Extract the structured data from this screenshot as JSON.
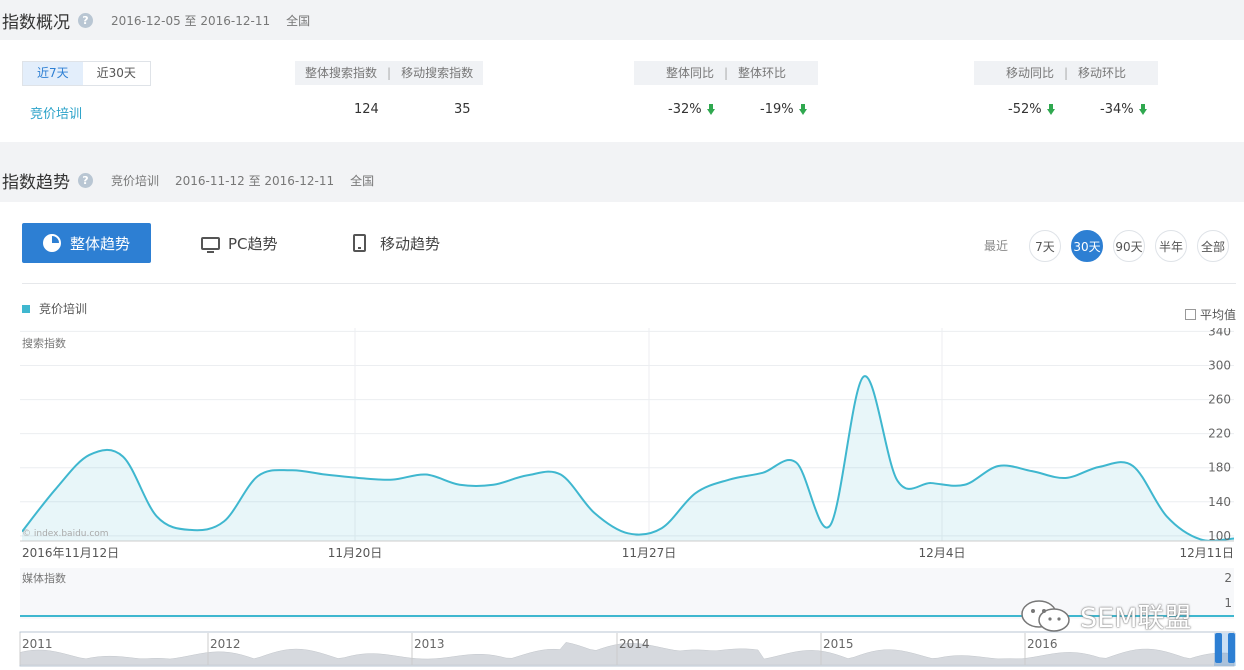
{
  "overview": {
    "title": "指数概况",
    "date_range": "2016-12-05 至 2016-12-11",
    "region": "全国",
    "range_tabs": [
      "近7天",
      "近30天"
    ],
    "keyword": "竞价培训",
    "search_group": {
      "labels": [
        "整体搜索指数",
        "移动搜索指数"
      ],
      "values": [
        "124",
        "35"
      ]
    },
    "yoy_group": {
      "labels": [
        "整体同比",
        "整体环比"
      ],
      "values": [
        "-32%",
        "-19%"
      ]
    },
    "mobile_group": {
      "labels": [
        "移动同比",
        "移动环比"
      ],
      "values": [
        "-52%",
        "-34%"
      ]
    }
  },
  "trend": {
    "title": "指数趋势",
    "keyword": "竞价培训",
    "date_range": "2016-11-12 至 2016-12-11",
    "region": "全国",
    "tabs": [
      "整体趋势",
      "PC趋势",
      "移动趋势"
    ],
    "recent_label": "最近",
    "ranges": [
      "7天",
      "30天",
      "90天",
      "半年",
      "全部"
    ],
    "avg_label": "平均值",
    "watermark_site": "© index.baidu.com"
  },
  "colors": {
    "accent": "#2d7fd3",
    "series": "#3fb7cf",
    "down": "#2fa84f"
  },
  "chart_data": [
    {
      "type": "area",
      "series": [
        {
          "name": "竞价培训",
          "values": [
            105,
            155,
            195,
            193,
            123,
            107,
            117,
            170,
            177,
            172,
            168,
            166,
            172,
            160,
            160,
            171,
            172,
            127,
            103,
            109,
            150,
            166,
            174,
            186,
            112,
            287,
            165,
            162,
            160,
            182,
            176,
            168,
            181,
            182,
            123,
            96,
            97
          ]
        }
      ],
      "x_ticks": [
        "2016年11月12日",
        "11月20日",
        "11月27日",
        "12月4日",
        "12月11日"
      ],
      "ylabel": "搜索指数",
      "y_ticks": [
        100,
        140,
        180,
        220,
        260,
        300,
        340
      ],
      "ylim": [
        94,
        344
      ],
      "grid": true,
      "legend": "top-left"
    },
    {
      "type": "line",
      "ylabel": "媒体指数",
      "y_ticks": [
        1,
        2
      ],
      "ylim": [
        0,
        2
      ],
      "values": [
        0
      ]
    },
    {
      "type": "area",
      "x_ticks": [
        "2011",
        "2012",
        "2013",
        "2014",
        "2015",
        "2016"
      ]
    }
  ],
  "watermark": "SEM联盟"
}
